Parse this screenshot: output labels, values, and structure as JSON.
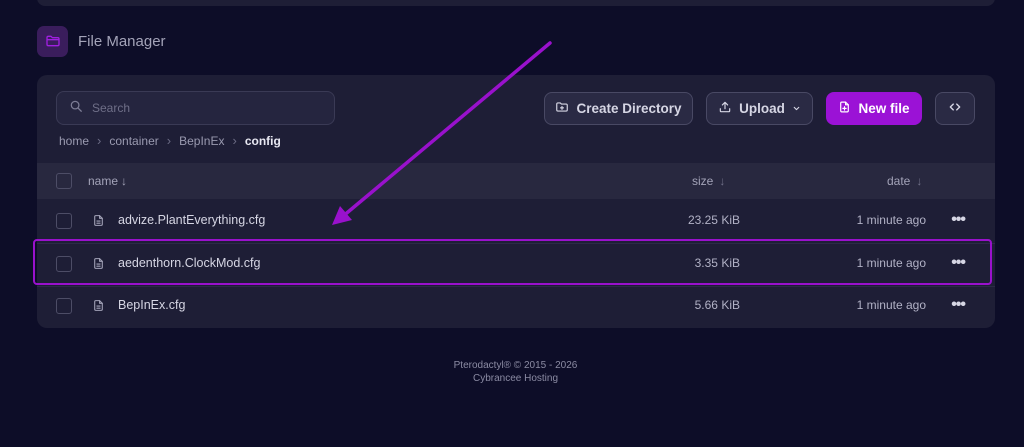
{
  "header": {
    "title": "File Manager",
    "icon": "folder-icon"
  },
  "search": {
    "placeholder": "Search",
    "value": ""
  },
  "toolbar": {
    "create_directory_label": "Create Directory",
    "upload_label": "Upload",
    "new_file_label": "New file",
    "code_icon": "code-icon"
  },
  "breadcrumb": {
    "items": [
      "home",
      "container",
      "BepInEx"
    ],
    "current": "config"
  },
  "table": {
    "columns": {
      "name": "name",
      "size": "size",
      "date": "date"
    },
    "sort_arrow": "↓",
    "rows": [
      {
        "name": "advize.PlantEverything.cfg",
        "size": "23.25 KiB",
        "date": "1 minute ago"
      },
      {
        "name": "aedenthorn.ClockMod.cfg",
        "size": "3.35 KiB",
        "date": "1 minute ago"
      },
      {
        "name": "BepInEx.cfg",
        "size": "5.66 KiB",
        "date": "1 minute ago"
      }
    ]
  },
  "footer": {
    "line1": "Pterodactyl® © 2015 - 2026",
    "line2": "Cybrancee Hosting"
  },
  "colors": {
    "accent": "#9b12d6",
    "background": "#0d0d28",
    "card": "#1e1e36",
    "annotation": "#9911cc"
  }
}
